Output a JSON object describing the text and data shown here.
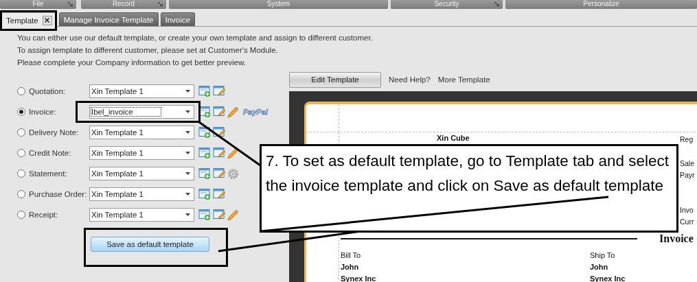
{
  "menu_bar": [
    {
      "label": "File"
    },
    {
      "label": "Record"
    },
    {
      "label": "System"
    },
    {
      "label": "Security"
    },
    {
      "label": "Personalize"
    }
  ],
  "tabs": [
    {
      "label": "Template",
      "selected": true,
      "closable": true
    },
    {
      "label": "Manage Invoice Template",
      "selected": false,
      "closable": false
    },
    {
      "label": "Invoice",
      "selected": false,
      "closable": false
    }
  ],
  "intro": [
    "You can either use our default template, or create your own template and assign to different customer.",
    "To assign template to different customer, please set at Customer's Module.",
    "Please complete your Company information to get better preview."
  ],
  "template_rows": [
    {
      "label": "Quotation:",
      "selected": false,
      "value": "Xin Template 1"
    },
    {
      "label": "Invoice:",
      "selected": true,
      "value": "Ibel_invoice",
      "extras": [
        {
          "kind": "pencil"
        },
        {
          "kind": "paypal",
          "text": "PayPal"
        }
      ]
    },
    {
      "label": "Delivery Note:",
      "selected": false,
      "value": "Xin Template 1"
    },
    {
      "label": "Credit Note:",
      "selected": false,
      "value": "Xin Template 1",
      "extras": [
        {
          "kind": "pencil"
        }
      ]
    },
    {
      "label": "Statement:",
      "selected": false,
      "value": "Xin Template 1",
      "extras": [
        {
          "kind": "gear"
        }
      ]
    },
    {
      "label": "Purchase Order:",
      "selected": false,
      "value": "Xin Template 1"
    },
    {
      "label": "Receipt:",
      "selected": false,
      "value": "Xin Template 1",
      "extras": [
        {
          "kind": "pencil"
        }
      ]
    }
  ],
  "save_button": "Save as default template",
  "toolbar": {
    "edit_button": "Edit Template",
    "links": [
      "Need Help?",
      "More Template"
    ]
  },
  "preview": {
    "company": "Xin Cube",
    "right_top": [
      "Reg"
    ],
    "right_middle": [
      "Sale",
      "Payr"
    ],
    "right_bottom": [
      "Invo",
      "Curr"
    ],
    "title": "Invoice",
    "bill_to": {
      "heading": "Bill To",
      "lines": [
        "John",
        "Synex Inc"
      ]
    },
    "ship_to": {
      "heading": "Ship To",
      "lines": [
        "John",
        "Synex Inc"
      ]
    }
  },
  "annotation": {
    "text": "7. To set as default template, go to Template tab and select the invoice template and click on Save as default template"
  }
}
